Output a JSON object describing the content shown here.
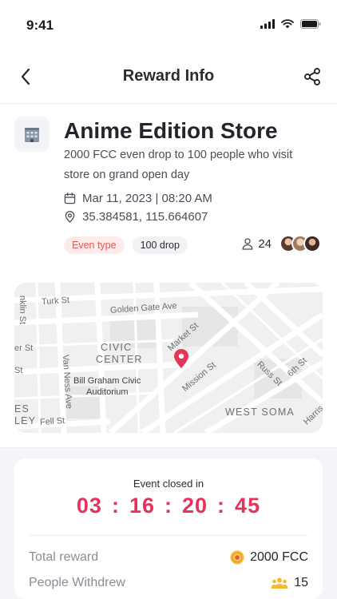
{
  "status_bar": {
    "time": "9:41"
  },
  "nav": {
    "title": "Reward Info"
  },
  "store": {
    "name": "Anime Edition Store",
    "description": "2000 FCC even drop to 100 people who visit store on grand open day",
    "date": "Mar 11, 2023 | 08:20 AM",
    "coordinates": "35.384581, 115.664607",
    "tags": [
      "Even type",
      "100 drop"
    ],
    "participant_count": "24"
  },
  "map": {
    "streets": [
      "Turk St",
      "Golden Gate Ave",
      "nklin St",
      "er St",
      "St",
      "Van Ness Ave",
      "Market St",
      "Mission St",
      "Russ St",
      "6th St",
      "Harris",
      "Fell St"
    ],
    "districts": [
      "CIVIC",
      "CENTER",
      "WEST SOMA",
      "ES",
      "LEY"
    ],
    "places": [
      "Bill Graham Civic",
      "Auditorium"
    ]
  },
  "reward": {
    "caption": "Event closed in",
    "countdown": {
      "hours": "03",
      "minutes": "16",
      "seconds": "20",
      "centis": "45"
    },
    "total_reward_label": "Total reward",
    "total_reward_value": "2000 FCC",
    "people_withdrew_label": "People Withdrew",
    "people_withdrew_value": "15"
  },
  "colors": {
    "accent": "#e6335a",
    "tag_type_bg": "#fdeceb",
    "tag_type_text": "#e55757",
    "coin": "#f5b82e"
  }
}
